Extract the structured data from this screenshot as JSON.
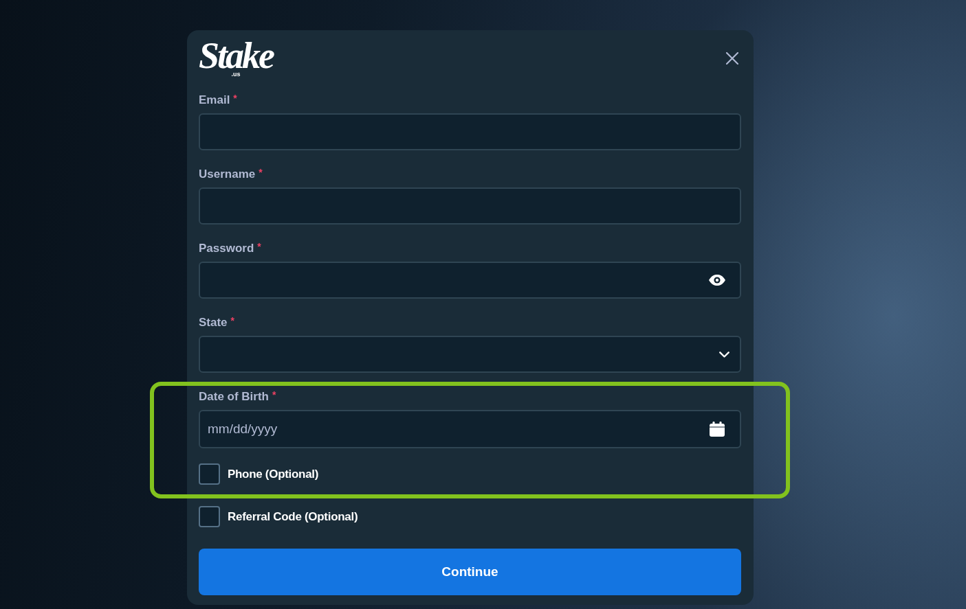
{
  "logo": {
    "name": "Stake",
    "suffix": ".us"
  },
  "form": {
    "items": [
      {
        "kind": "text",
        "label": "Email",
        "required_mark": "*",
        "highlighted": false
      },
      {
        "kind": "text",
        "label": "Username",
        "required_mark": "*",
        "highlighted": false
      },
      {
        "kind": "password",
        "label": "Password",
        "required_mark": "*",
        "highlighted": false
      },
      {
        "kind": "select",
        "label": "State",
        "required_mark": "*",
        "highlighted": false
      },
      {
        "kind": "date",
        "label": "Date of Birth",
        "required_mark": "*",
        "placeholder": "mm/dd/yyyy",
        "highlighted": true
      },
      {
        "kind": "checkbox",
        "label": "Phone (Optional)",
        "checked": false,
        "highlighted": true
      },
      {
        "kind": "checkbox",
        "label": "Referral Code (Optional)",
        "checked": false,
        "highlighted": false
      }
    ]
  },
  "submit": {
    "label": "Continue"
  }
}
